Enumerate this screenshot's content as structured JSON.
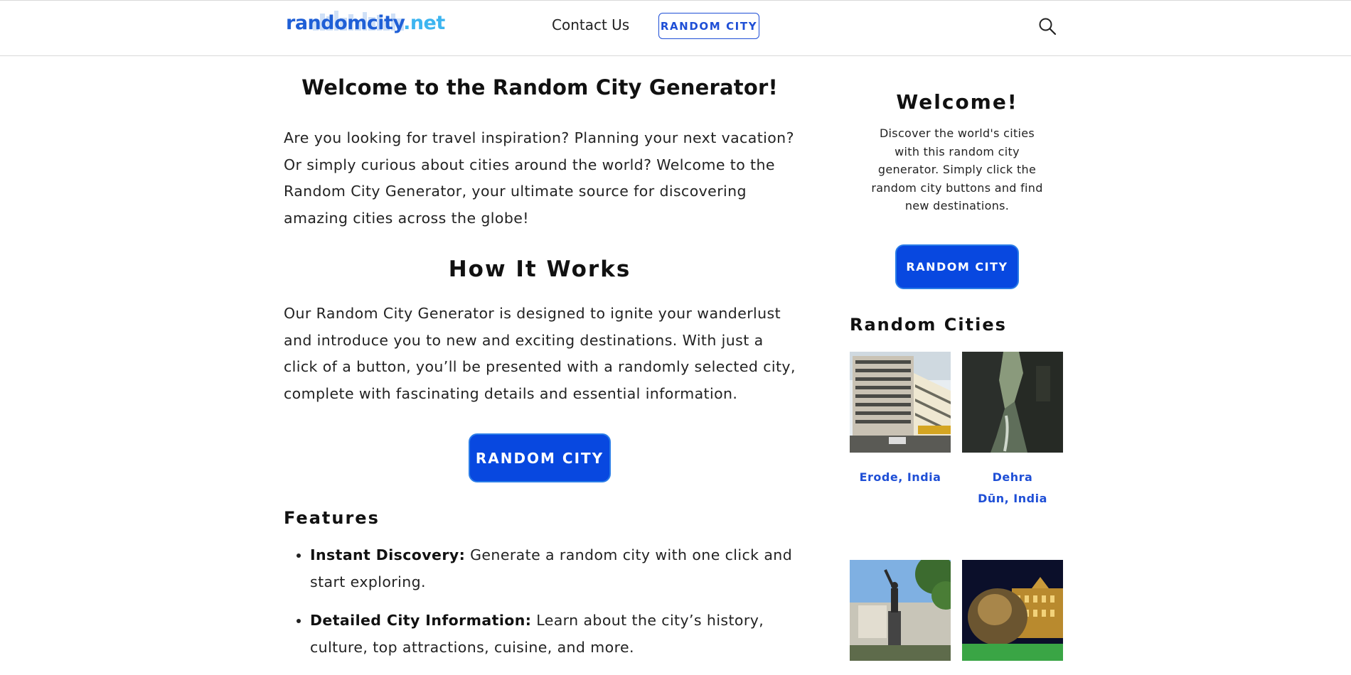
{
  "header": {
    "logo_main": "randomcity",
    "logo_tld": ".net",
    "nav_contact": "Contact Us",
    "nav_random": "RANDOM CITY"
  },
  "main": {
    "title": "Welcome to the Random City Generator!",
    "intro": "Are you looking for travel inspiration? Planning your next vacation? Or simply curious about cities around the world? Welcome to the Random City Generator, your ultimate source for discovering amazing cities across the globe!",
    "how_heading": "How It Works",
    "how_text": "Our Random City Generator is designed to ignite your wanderlust and introduce you to new and exciting destinations. With just a click of a button, you’ll be presented with a randomly selected city, complete with fascinating details and essential information.",
    "button_label": "RANDOM CITY",
    "features_heading": "Features",
    "features": [
      {
        "title": "Instant Discovery:",
        "text": " Generate a random city with one click and start exploring."
      },
      {
        "title": "Detailed City Information:",
        "text": " Learn about the city’s history, culture, top attractions, cuisine, and more."
      }
    ]
  },
  "sidebar": {
    "title": "Welcome!",
    "text": "Discover the world's cities with this random city generator. Simply click the random city buttons and find new destinations.",
    "button_label": "RANDOM CITY",
    "cities_heading": "Random Cities",
    "cities": [
      {
        "name": "Erode, India"
      },
      {
        "name": "Dehra Dūn, India"
      },
      {
        "name": ""
      },
      {
        "name": ""
      }
    ]
  },
  "colors": {
    "accent": "#0848e0",
    "link": "#1f4fd6",
    "logo_tld": "#3db5f0"
  },
  "icons": {
    "search": "search-icon"
  }
}
